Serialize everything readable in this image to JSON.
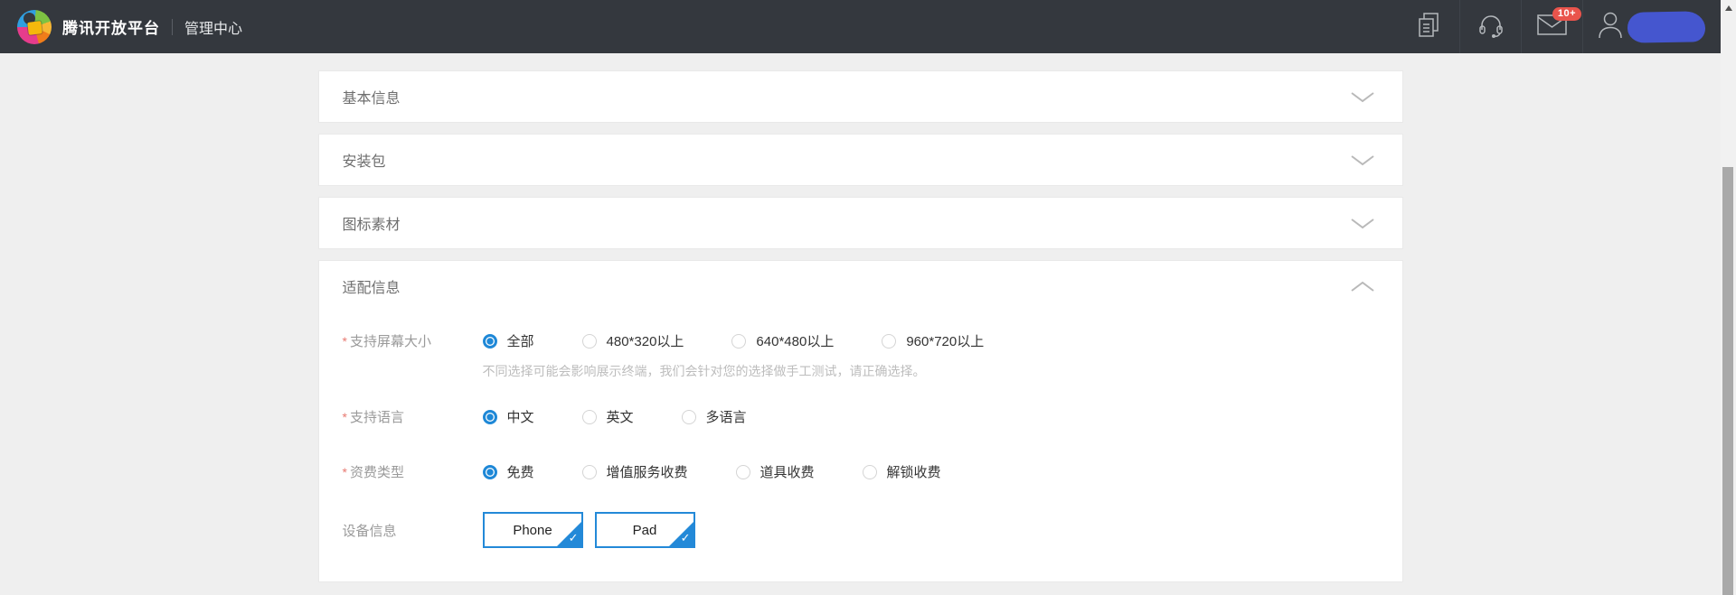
{
  "header": {
    "brand": "腾讯开放平台",
    "nav_title": "管理中心",
    "mail_badge": "10+",
    "icons": [
      "documents-icon",
      "headset-icon",
      "mail-icon",
      "user-icon"
    ]
  },
  "colors": {
    "header_bg": "#34383e",
    "page_bg": "#efefef",
    "accent_blue": "#1e88d7",
    "badge_red": "#e9544c",
    "required_star": "#e87a72"
  },
  "panels": [
    {
      "id": "basic-info",
      "title": "基本信息",
      "state": "collapsed"
    },
    {
      "id": "package",
      "title": "安装包",
      "state": "collapsed"
    },
    {
      "id": "icon-assets",
      "title": "图标素材",
      "state": "collapsed"
    },
    {
      "id": "adaptation",
      "title": "适配信息",
      "state": "expanded"
    }
  ],
  "form": {
    "rows": [
      {
        "id": "screen-size",
        "label": "支持屏幕大小",
        "required": true,
        "type": "radio",
        "options": [
          {
            "id": "all",
            "label": "全部",
            "selected": true
          },
          {
            "id": "480x320",
            "label": "480*320以上",
            "selected": false
          },
          {
            "id": "640x480",
            "label": "640*480以上",
            "selected": false
          },
          {
            "id": "960x720",
            "label": "960*720以上",
            "selected": false
          }
        ],
        "note": "不同选择可能会影响展示终端，我们会针对您的选择做手工测试，请正确选择。"
      },
      {
        "id": "language",
        "label": "支持语言",
        "required": true,
        "type": "radio",
        "options": [
          {
            "id": "chinese",
            "label": "中文",
            "selected": true
          },
          {
            "id": "english",
            "label": "英文",
            "selected": false
          },
          {
            "id": "multilingual",
            "label": "多语言",
            "selected": false
          }
        ]
      },
      {
        "id": "fee-type",
        "label": "资费类型",
        "required": true,
        "type": "radio",
        "options": [
          {
            "id": "free",
            "label": "免费",
            "selected": true
          },
          {
            "id": "value-added",
            "label": "增值服务收费",
            "selected": false
          },
          {
            "id": "props",
            "label": "道具收费",
            "selected": false
          },
          {
            "id": "unlock",
            "label": "解锁收费",
            "selected": false
          }
        ]
      },
      {
        "id": "device-info",
        "label": "设备信息",
        "required": false,
        "type": "toggle-buttons",
        "options": [
          {
            "id": "phone",
            "label": "Phone",
            "selected": true
          },
          {
            "id": "pad",
            "label": "Pad",
            "selected": true
          }
        ]
      }
    ]
  }
}
